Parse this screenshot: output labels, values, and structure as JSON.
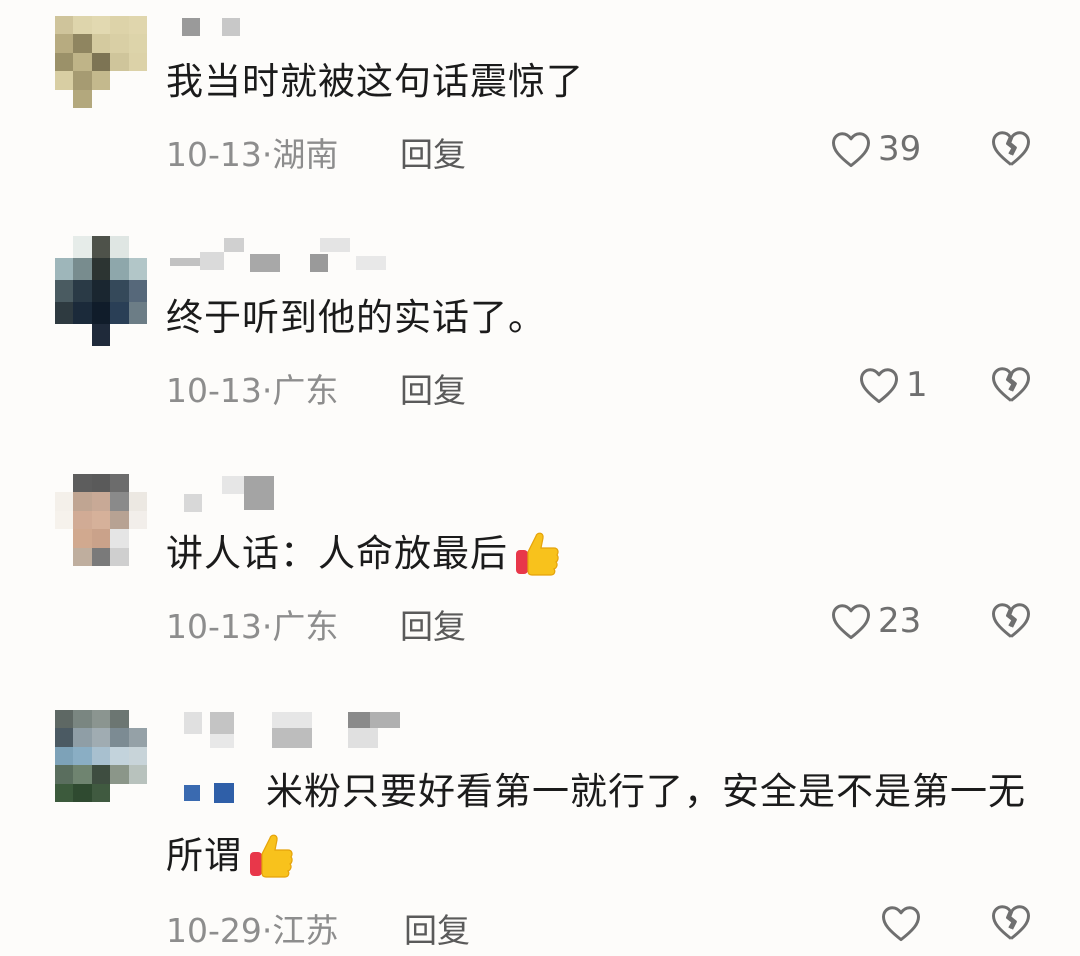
{
  "comments": [
    {
      "text": "我当时就被这句话震惊了",
      "date": "10-13",
      "location": "湖南",
      "reply_label": "回复",
      "likes": "39"
    },
    {
      "text": "终于听到他的实话了。",
      "date": "10-13",
      "location": "广东",
      "reply_label": "回复",
      "likes": "1"
    },
    {
      "text": "讲人话：人命放最后",
      "date": "10-13",
      "location": "广东",
      "reply_label": "回复",
      "likes": "23"
    },
    {
      "text": "米粉只要好看第一就行了，安全是不是第一无所谓",
      "date": "10-29",
      "location": "江苏",
      "reply_label": "回复",
      "likes": ""
    }
  ],
  "icons": {
    "like": "heart-outline-icon",
    "dislike": "broken-heart-icon",
    "emoji": "thumbs-up-emoji"
  },
  "colors": {
    "text": "#1b1b1b",
    "meta": "#8d8d8d",
    "icon": "#6f6f6f",
    "background": "#fdfcfa"
  }
}
